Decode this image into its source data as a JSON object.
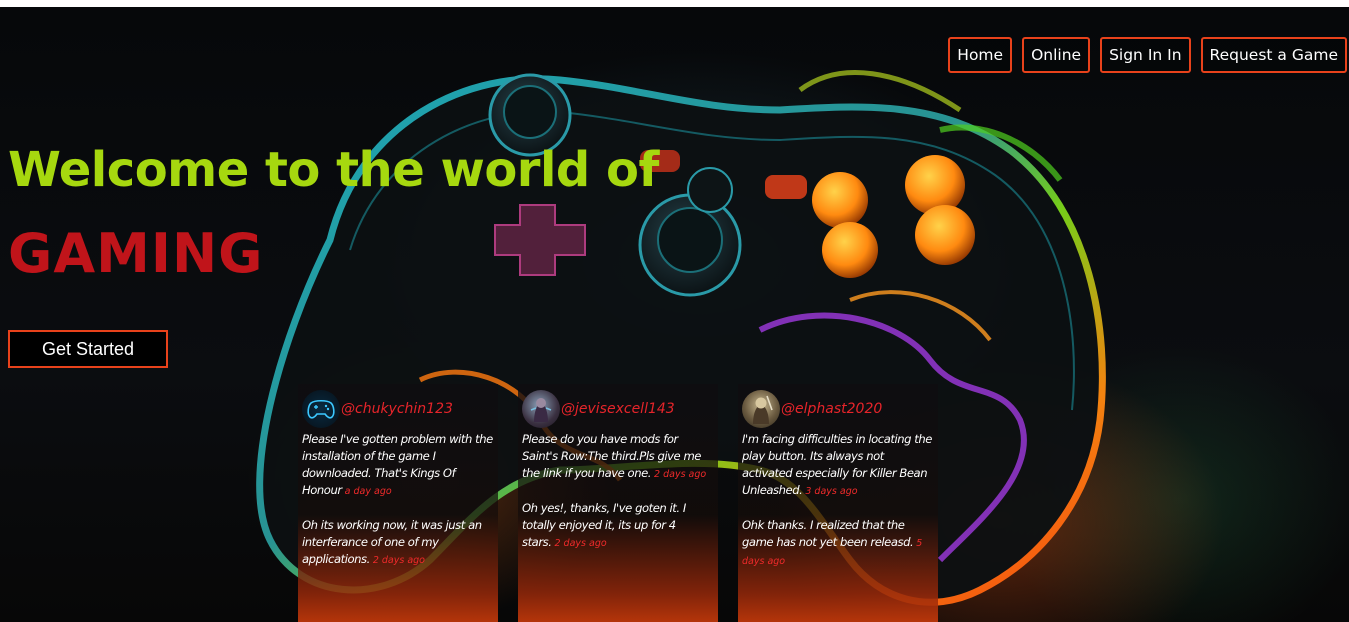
{
  "nav": {
    "items": [
      {
        "label": "Home"
      },
      {
        "label": "Online"
      },
      {
        "label": "Sign In In"
      },
      {
        "label": "Request a Game"
      }
    ]
  },
  "hero": {
    "title": "Welcome to the world of",
    "subtitle": "GAMING",
    "cta_label": "Get Started"
  },
  "comments": [
    {
      "handle": "@chukychin123",
      "avatar_icon": "gamepad-avatar-icon",
      "messages": [
        {
          "text": "Please I've gotten problem with the installation of the game I downloaded. That's Kings Of Honour",
          "time": "a day ago"
        },
        {
          "text": "Oh its working now, it was just an interferance of one of my applications.",
          "time": "2 days ago"
        }
      ]
    },
    {
      "handle": "@jevisexcell143",
      "avatar_icon": "character-avatar-icon",
      "messages": [
        {
          "text": "Please do you have mods for Saint's Row:The third.Pls give me the link if you have one.",
          "time": "2 days ago"
        },
        {
          "text": "Oh yes!, thanks, I've goten it. I totally enjoyed it, its up for 4 stars.",
          "time": "2 days ago"
        }
      ]
    },
    {
      "handle": "@elphast2020",
      "avatar_icon": "warrior-avatar-icon",
      "messages": [
        {
          "text": "I'm facing difficulties in locating the play button. Its always not activated especially for Killer Bean Unleashed.",
          "time": "3 days ago"
        },
        {
          "text": "Ohk thanks. I realized that the game has not yet been releasd.",
          "time": "5 days ago"
        }
      ]
    }
  ],
  "colors": {
    "accent_border": "#e8421b",
    "title_green": "#a6d80f",
    "title_red": "#c0141a",
    "handle_red": "#e5242a"
  }
}
